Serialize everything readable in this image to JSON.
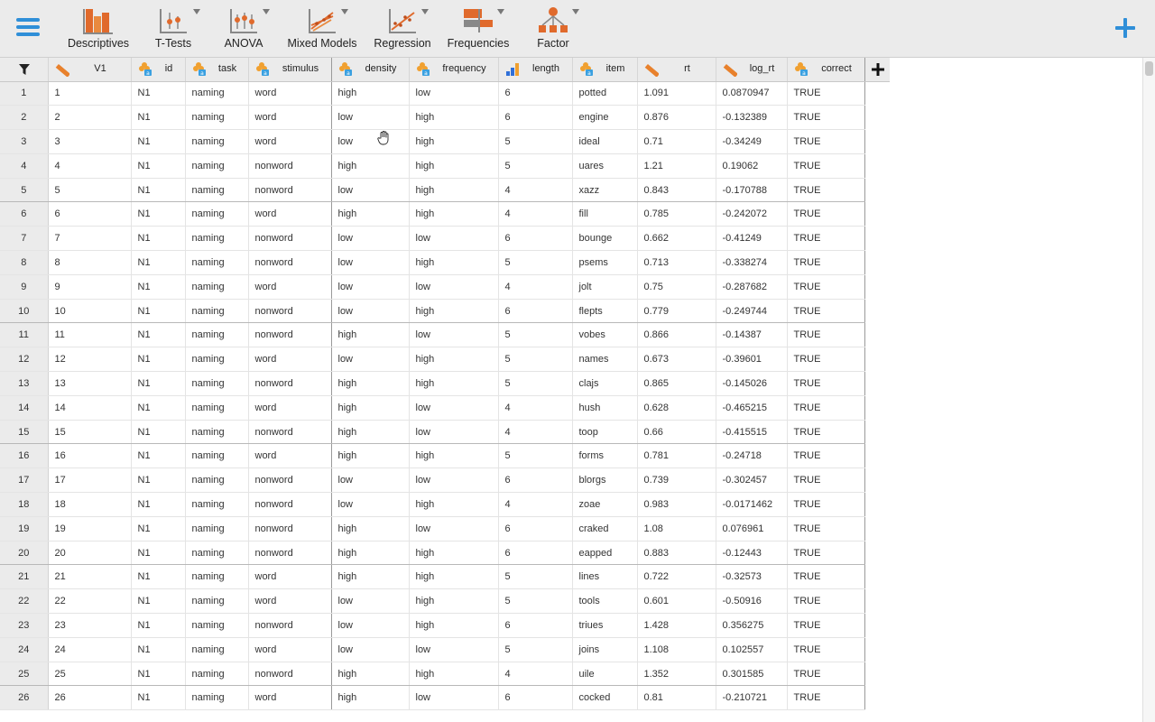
{
  "toolbar": {
    "tools": [
      {
        "label": "Descriptives",
        "icon": "descriptives-icon",
        "caret": false
      },
      {
        "label": "T-Tests",
        "icon": "ttests-icon",
        "caret": true
      },
      {
        "label": "ANOVA",
        "icon": "anova-icon",
        "caret": true
      },
      {
        "label": "Mixed Models",
        "icon": "mixed-models-icon",
        "caret": true
      },
      {
        "label": "Regression",
        "icon": "regression-icon",
        "caret": true
      },
      {
        "label": "Frequencies",
        "icon": "frequencies-icon",
        "caret": true
      },
      {
        "label": "Factor",
        "icon": "factor-icon",
        "caret": true
      }
    ]
  },
  "colors": {
    "accent": "#2f8fd8",
    "ruler": "#e8812c",
    "nominal_dot": "#f0a030",
    "text_badge": "#3aa0e0",
    "ordinal_bar": "#2f6fd8"
  },
  "grid": {
    "columns": [
      {
        "name": "V1",
        "type": "ruler"
      },
      {
        "name": "id",
        "type": "nominal-text"
      },
      {
        "name": "task",
        "type": "nominal-text"
      },
      {
        "name": "stimulus",
        "type": "nominal-text"
      },
      {
        "name": "density",
        "type": "nominal-text"
      },
      {
        "name": "frequency",
        "type": "nominal-text"
      },
      {
        "name": "length",
        "type": "ordinal"
      },
      {
        "name": "item",
        "type": "nominal-text"
      },
      {
        "name": "rt",
        "type": "ruler"
      },
      {
        "name": "log_rt",
        "type": "ruler"
      },
      {
        "name": "correct",
        "type": "nominal-text"
      }
    ],
    "rows": [
      [
        "1",
        "1",
        "N1",
        "naming",
        "word",
        "high",
        "low",
        "6",
        "potted",
        "1.091",
        "0.0870947",
        "TRUE"
      ],
      [
        "2",
        "2",
        "N1",
        "naming",
        "word",
        "low",
        "high",
        "6",
        "engine",
        "0.876",
        "-0.132389",
        "TRUE"
      ],
      [
        "3",
        "3",
        "N1",
        "naming",
        "word",
        "low",
        "high",
        "5",
        "ideal",
        "0.71",
        "-0.34249",
        "TRUE"
      ],
      [
        "4",
        "4",
        "N1",
        "naming",
        "nonword",
        "high",
        "high",
        "5",
        "uares",
        "1.21",
        "0.19062",
        "TRUE"
      ],
      [
        "5",
        "5",
        "N1",
        "naming",
        "nonword",
        "low",
        "high",
        "4",
        "xazz",
        "0.843",
        "-0.170788",
        "TRUE"
      ],
      [
        "6",
        "6",
        "N1",
        "naming",
        "word",
        "high",
        "high",
        "4",
        "fill",
        "0.785",
        "-0.242072",
        "TRUE"
      ],
      [
        "7",
        "7",
        "N1",
        "naming",
        "nonword",
        "low",
        "low",
        "6",
        "bounge",
        "0.662",
        "-0.41249",
        "TRUE"
      ],
      [
        "8",
        "8",
        "N1",
        "naming",
        "nonword",
        "low",
        "high",
        "5",
        "psems",
        "0.713",
        "-0.338274",
        "TRUE"
      ],
      [
        "9",
        "9",
        "N1",
        "naming",
        "word",
        "low",
        "low",
        "4",
        "jolt",
        "0.75",
        "-0.287682",
        "TRUE"
      ],
      [
        "10",
        "10",
        "N1",
        "naming",
        "nonword",
        "low",
        "high",
        "6",
        "flepts",
        "0.779",
        "-0.249744",
        "TRUE"
      ],
      [
        "11",
        "11",
        "N1",
        "naming",
        "nonword",
        "high",
        "low",
        "5",
        "vobes",
        "0.866",
        "-0.14387",
        "TRUE"
      ],
      [
        "12",
        "12",
        "N1",
        "naming",
        "word",
        "low",
        "high",
        "5",
        "names",
        "0.673",
        "-0.39601",
        "TRUE"
      ],
      [
        "13",
        "13",
        "N1",
        "naming",
        "nonword",
        "high",
        "high",
        "5",
        "clajs",
        "0.865",
        "-0.145026",
        "TRUE"
      ],
      [
        "14",
        "14",
        "N1",
        "naming",
        "word",
        "high",
        "low",
        "4",
        "hush",
        "0.628",
        "-0.465215",
        "TRUE"
      ],
      [
        "15",
        "15",
        "N1",
        "naming",
        "nonword",
        "high",
        "low",
        "4",
        "toop",
        "0.66",
        "-0.415515",
        "TRUE"
      ],
      [
        "16",
        "16",
        "N1",
        "naming",
        "word",
        "high",
        "high",
        "5",
        "forms",
        "0.781",
        "-0.24718",
        "TRUE"
      ],
      [
        "17",
        "17",
        "N1",
        "naming",
        "nonword",
        "low",
        "low",
        "6",
        "blorgs",
        "0.739",
        "-0.302457",
        "TRUE"
      ],
      [
        "18",
        "18",
        "N1",
        "naming",
        "nonword",
        "low",
        "high",
        "4",
        "zoae",
        "0.983",
        "-0.0171462",
        "TRUE"
      ],
      [
        "19",
        "19",
        "N1",
        "naming",
        "nonword",
        "high",
        "low",
        "6",
        "craked",
        "1.08",
        "0.076961",
        "TRUE"
      ],
      [
        "20",
        "20",
        "N1",
        "naming",
        "nonword",
        "high",
        "high",
        "6",
        "eapped",
        "0.883",
        "-0.12443",
        "TRUE"
      ],
      [
        "21",
        "21",
        "N1",
        "naming",
        "word",
        "high",
        "high",
        "5",
        "lines",
        "0.722",
        "-0.32573",
        "TRUE"
      ],
      [
        "22",
        "22",
        "N1",
        "naming",
        "word",
        "low",
        "high",
        "5",
        "tools",
        "0.601",
        "-0.50916",
        "TRUE"
      ],
      [
        "23",
        "23",
        "N1",
        "naming",
        "nonword",
        "low",
        "high",
        "6",
        "triues",
        "1.428",
        "0.356275",
        "TRUE"
      ],
      [
        "24",
        "24",
        "N1",
        "naming",
        "word",
        "low",
        "low",
        "5",
        "joins",
        "1.108",
        "0.102557",
        "TRUE"
      ],
      [
        "25",
        "25",
        "N1",
        "naming",
        "nonword",
        "high",
        "high",
        "4",
        "uile",
        "1.352",
        "0.301585",
        "TRUE"
      ],
      [
        "26",
        "26",
        "N1",
        "naming",
        "word",
        "high",
        "low",
        "6",
        "cocked",
        "0.81",
        "-0.210721",
        "TRUE"
      ]
    ]
  }
}
